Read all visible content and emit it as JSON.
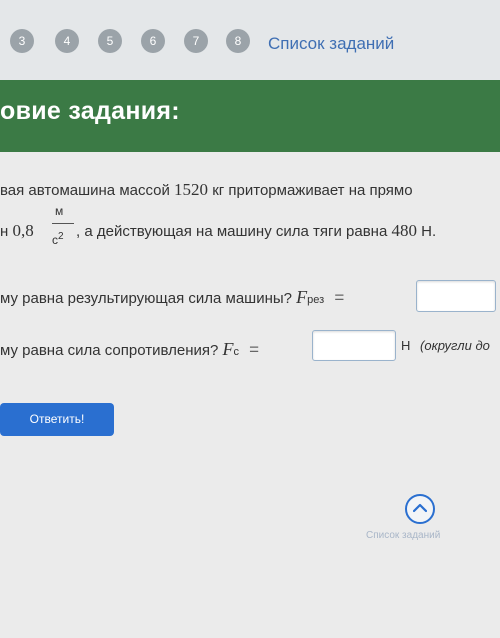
{
  "nav": {
    "pages": [
      "3",
      "4",
      "5",
      "6",
      "7",
      "8"
    ],
    "task_list": "Список заданий"
  },
  "header": {
    "title": "овие задания:"
  },
  "task": {
    "line1_a": "вая автомашина массой ",
    "mass": "1520",
    "line1_b": " кг притормаживает на прямо",
    "line2_prefix": "н ",
    "accel": "0,8",
    "unit_num": "м",
    "unit_den": "с",
    "unit_exp": "2",
    "line2_mid": ", а действующая на машину сила тяги равна ",
    "force": "480",
    "line2_unit": " Н."
  },
  "q1": {
    "label": "му равна результирующая сила машины?",
    "var": "F",
    "sub": "рез",
    "eq": "="
  },
  "q2": {
    "label": "му равна сила сопротивления?",
    "var": "F",
    "sub": "с",
    "eq": "=",
    "unit": "Н",
    "hint": "(округли до"
  },
  "answer_button": "Ответить!",
  "footer": {
    "link": "Список заданий"
  },
  "colors": {
    "header_bg": "#3b7a45",
    "button": "#2a6fd0",
    "link": "#3f6fb3",
    "page_circle": "#9ba3a9"
  }
}
